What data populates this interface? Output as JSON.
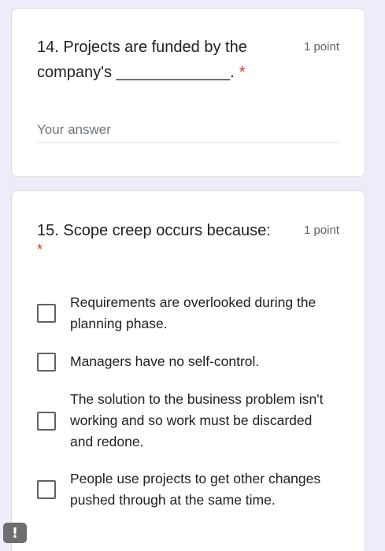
{
  "question14": {
    "title": "14. Projects are funded by the company's _____________.",
    "points": "1 point",
    "required_mark": "*",
    "answer_placeholder": "Your answer"
  },
  "question15": {
    "title": "15. Scope creep occurs because:",
    "points": "1 point",
    "required_mark": "*",
    "options": [
      {
        "label": "Requirements are overlooked during the planning phase."
      },
      {
        "label": "Managers have no self-control."
      },
      {
        "label": "The solution to the business problem isn't working and so work must be discarded and redone."
      },
      {
        "label": "People use projects to get other changes pushed through at the same time."
      }
    ]
  },
  "feedback_button": {
    "label": "!"
  }
}
